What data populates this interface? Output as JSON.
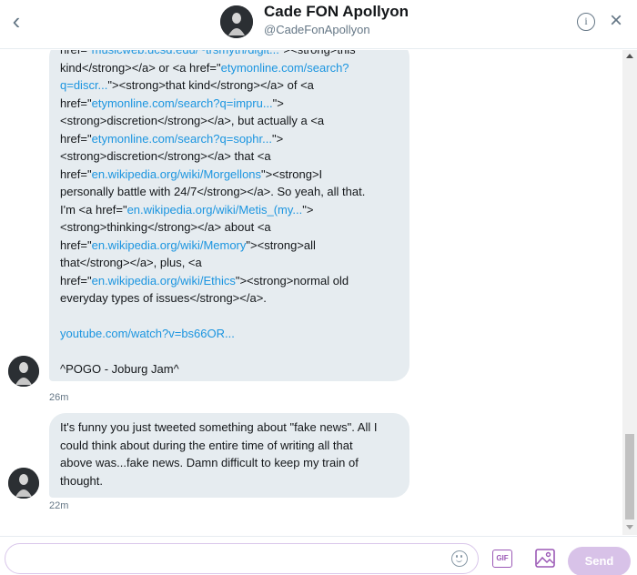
{
  "header": {
    "back_icon": "chevron-left-icon",
    "name": "Cade FON Apollyon",
    "handle": "@CadeFonApollyon",
    "info_icon": "info-icon",
    "info_glyph": "i",
    "close_icon": "close-icon"
  },
  "thread": {
    "message1": {
      "lines": [
        [
          {
            "t": "href=\"",
            "link": false
          },
          {
            "t": "musicweb.ucsd.edu/~trsmyth/digit...",
            "link": true
          },
          {
            "t": "\"><strong>this",
            "link": false
          }
        ],
        [
          {
            "t": "kind</strong></a> or <a href=\"",
            "link": false
          },
          {
            "t": "etymonline.com/search?",
            "link": true
          }
        ],
        [
          {
            "t": "q=discr...",
            "link": true
          },
          {
            "t": "\"><strong>that kind</strong></a> of <a",
            "link": false
          }
        ],
        [
          {
            "t": "href=\"",
            "link": false
          },
          {
            "t": "etymonline.com/search?q=impru...",
            "link": true
          },
          {
            "t": "\">",
            "link": false
          }
        ],
        [
          {
            "t": "<strong>discretion</strong></a>, but actually a <a",
            "link": false
          }
        ],
        [
          {
            "t": "href=\"",
            "link": false
          },
          {
            "t": "etymonline.com/search?q=sophr...",
            "link": true
          },
          {
            "t": "\">",
            "link": false
          }
        ],
        [
          {
            "t": "<strong>discretion</strong></a> that <a",
            "link": false
          }
        ],
        [
          {
            "t": "href=\"",
            "link": false
          },
          {
            "t": "en.wikipedia.org/wiki/Morgellons",
            "link": true
          },
          {
            "t": "\"><strong>I",
            "link": false
          }
        ],
        [
          {
            "t": "personally battle with 24/7</strong></a>. So yeah, all that.",
            "link": false
          }
        ],
        [
          {
            "t": "I'm <a href=\"",
            "link": false
          },
          {
            "t": "en.wikipedia.org/wiki/Metis_(my...",
            "link": true
          },
          {
            "t": "\">",
            "link": false
          }
        ],
        [
          {
            "t": "<strong>thinking</strong></a> about <a",
            "link": false
          }
        ],
        [
          {
            "t": "href=\"",
            "link": false
          },
          {
            "t": "en.wikipedia.org/wiki/Memory",
            "link": true
          },
          {
            "t": "\"><strong>all",
            "link": false
          }
        ],
        [
          {
            "t": "that</strong></a>, plus, <a",
            "link": false
          }
        ],
        [
          {
            "t": "href=\"",
            "link": false
          },
          {
            "t": "en.wikipedia.org/wiki/Ethics",
            "link": true
          },
          {
            "t": "\"><strong>normal old",
            "link": false
          }
        ],
        [
          {
            "t": "everyday types of issues</strong></a>.",
            "link": false
          }
        ],
        [],
        [
          {
            "t": "youtube.com/watch?v=bs66OR...",
            "link": true
          }
        ],
        [],
        [
          {
            "t": "^POGO - Joburg Jam^",
            "link": false
          }
        ]
      ],
      "time": "26m"
    },
    "message2": {
      "lines": [
        [
          {
            "t": "It's funny you just tweeted something about \"fake news\". All I",
            "link": false
          }
        ],
        [
          {
            "t": "could think about during the entire time of writing all that",
            "link": false
          }
        ],
        [
          {
            "t": "above was...fake news. Damn difficult to keep my train of",
            "link": false
          }
        ],
        [
          {
            "t": "thought.",
            "link": false
          }
        ]
      ],
      "time": "22m"
    }
  },
  "composer": {
    "placeholder": "",
    "emoji_icon": "emoji-icon",
    "gif_icon": "gif-icon",
    "gif_label": "GIF",
    "image_icon": "image-icon",
    "send_label": "Send"
  },
  "colors": {
    "link": "#1b95e0",
    "bubble": "#e6ecf0",
    "send_disabled": "#d8c2e8",
    "accent": "#9b59b6"
  }
}
